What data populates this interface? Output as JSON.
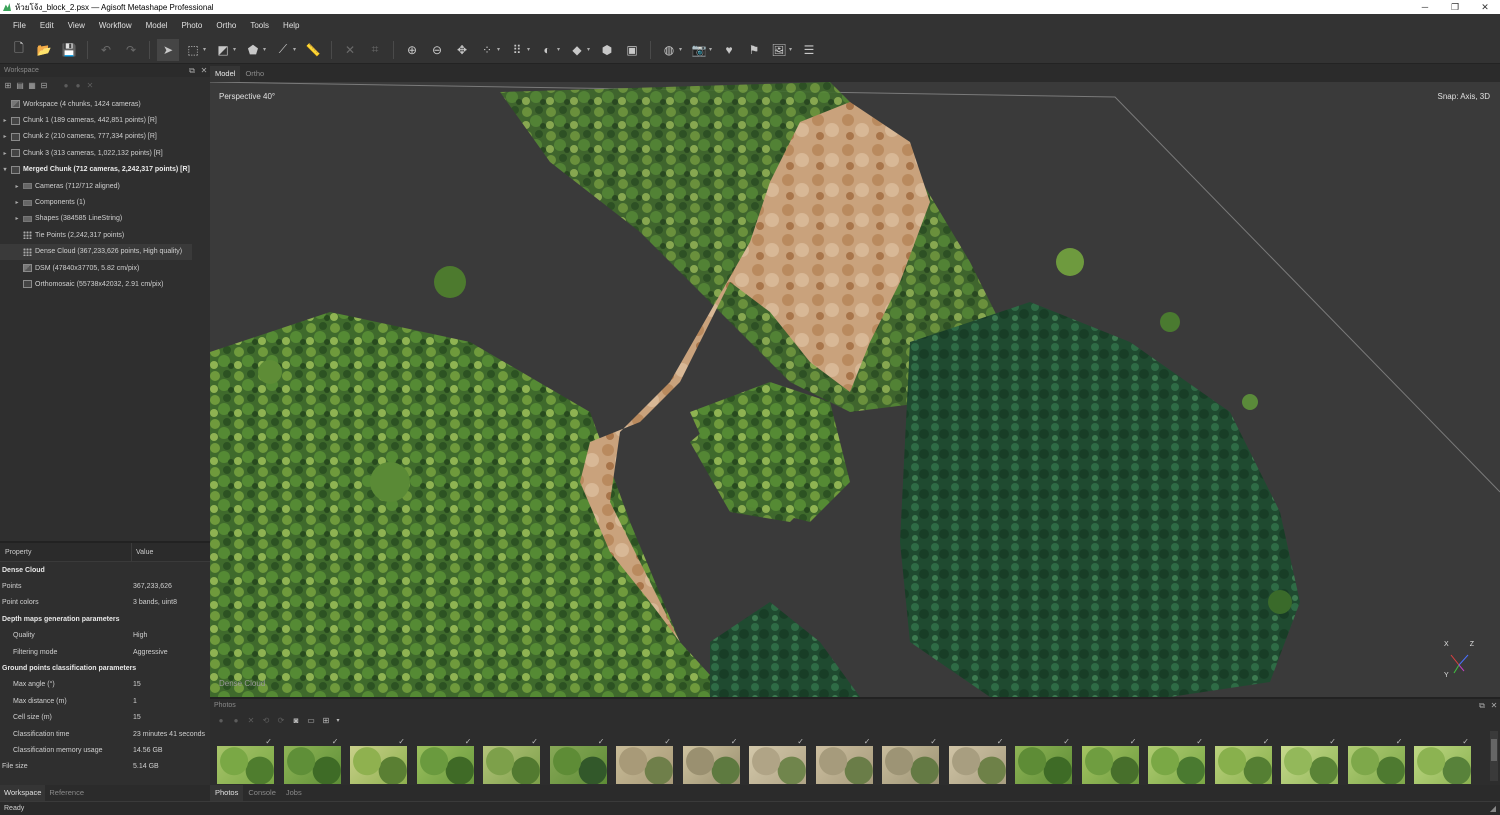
{
  "window": {
    "title": "ห้วยโจ้ง_block_2.psx — Agisoft Metashape Professional",
    "minimize": "─",
    "maximize": "❐",
    "close": "✕"
  },
  "menu": [
    "File",
    "Edit",
    "View",
    "Workflow",
    "Model",
    "Photo",
    "Ortho",
    "Tools",
    "Help"
  ],
  "workspace": {
    "title": "Workspace",
    "tree": [
      {
        "label": "Workspace (4 chunks, 1424 cameras)",
        "level": 0,
        "arrow": "",
        "icon": "img"
      },
      {
        "label": "Chunk 1 (189 cameras, 442,851 points) [R]",
        "level": 0,
        "arrow": "▸",
        "icon": "box"
      },
      {
        "label": "Chunk 2 (210 cameras, 777,334 points) [R]",
        "level": 0,
        "arrow": "▸",
        "icon": "box"
      },
      {
        "label": "Chunk 3 (313 cameras, 1,022,132 points) [R]",
        "level": 0,
        "arrow": "▸",
        "icon": "box"
      },
      {
        "label": "Merged Chunk (712 cameras, 2,242,317 points) [R]",
        "level": 0,
        "arrow": "▾",
        "icon": "box",
        "bold": true
      },
      {
        "label": "Cameras (712/712 aligned)",
        "level": 1,
        "arrow": "▸",
        "icon": "folder"
      },
      {
        "label": "Components (1)",
        "level": 1,
        "arrow": "▸",
        "icon": "folder"
      },
      {
        "label": "Shapes (384585 LineString)",
        "level": 1,
        "arrow": "▸",
        "icon": "folder"
      },
      {
        "label": "Tie Points (2,242,317 points)",
        "level": 1,
        "arrow": "",
        "icon": "dots"
      },
      {
        "label": "Dense Cloud (367,233,626 points, High quality)",
        "level": 1,
        "arrow": "",
        "icon": "dots",
        "selected": true
      },
      {
        "label": "DSM (47840x37705, 5.82 cm/pix)",
        "level": 1,
        "arrow": "",
        "icon": "img"
      },
      {
        "label": "Orthomosaic (55738x42032, 2.91 cm/pix)",
        "level": 1,
        "arrow": "",
        "icon": "box"
      }
    ]
  },
  "properties": {
    "col_property": "Property",
    "col_value": "Value",
    "rows": [
      {
        "k": "Dense Cloud",
        "v": "",
        "type": "group"
      },
      {
        "k": "Points",
        "v": "367,233,626",
        "type": "row"
      },
      {
        "k": "Point colors",
        "v": "3 bands, uint8",
        "type": "row"
      },
      {
        "k": "Depth maps generation parameters",
        "v": "",
        "type": "group"
      },
      {
        "k": "Quality",
        "v": "High",
        "type": "sub"
      },
      {
        "k": "Filtering mode",
        "v": "Aggressive",
        "type": "sub"
      },
      {
        "k": "Ground points classification parameters",
        "v": "",
        "type": "group"
      },
      {
        "k": "Max angle (°)",
        "v": "15",
        "type": "sub"
      },
      {
        "k": "Max distance (m)",
        "v": "1",
        "type": "sub"
      },
      {
        "k": "Cell size (m)",
        "v": "15",
        "type": "sub"
      },
      {
        "k": "Classification time",
        "v": "23 minutes 41 seconds",
        "type": "sub"
      },
      {
        "k": "Classification memory usage",
        "v": "14.56 GB",
        "type": "sub"
      },
      {
        "k": "File size",
        "v": "5.14 GB",
        "type": "row"
      }
    ]
  },
  "left_tabs": [
    "Workspace",
    "Reference"
  ],
  "view_tabs": [
    "Model",
    "Ortho"
  ],
  "viewport": {
    "projection": "Perspective 40°",
    "snap": "Snap: Axis, 3D",
    "overlay_text": "Dense Cloud",
    "axis_x": "X",
    "axis_y": "Y",
    "axis_z": "Z"
  },
  "photos_pane": {
    "title": "Photos",
    "thumb_count": 19,
    "check": "✓"
  },
  "bottom_tabs": [
    "Photos",
    "Console",
    "Jobs"
  ],
  "status": {
    "text": "Ready"
  },
  "colors": {
    "accent": "#3aa35a",
    "panel": "#2f2f2f",
    "viewport": "#3a3a3a"
  }
}
